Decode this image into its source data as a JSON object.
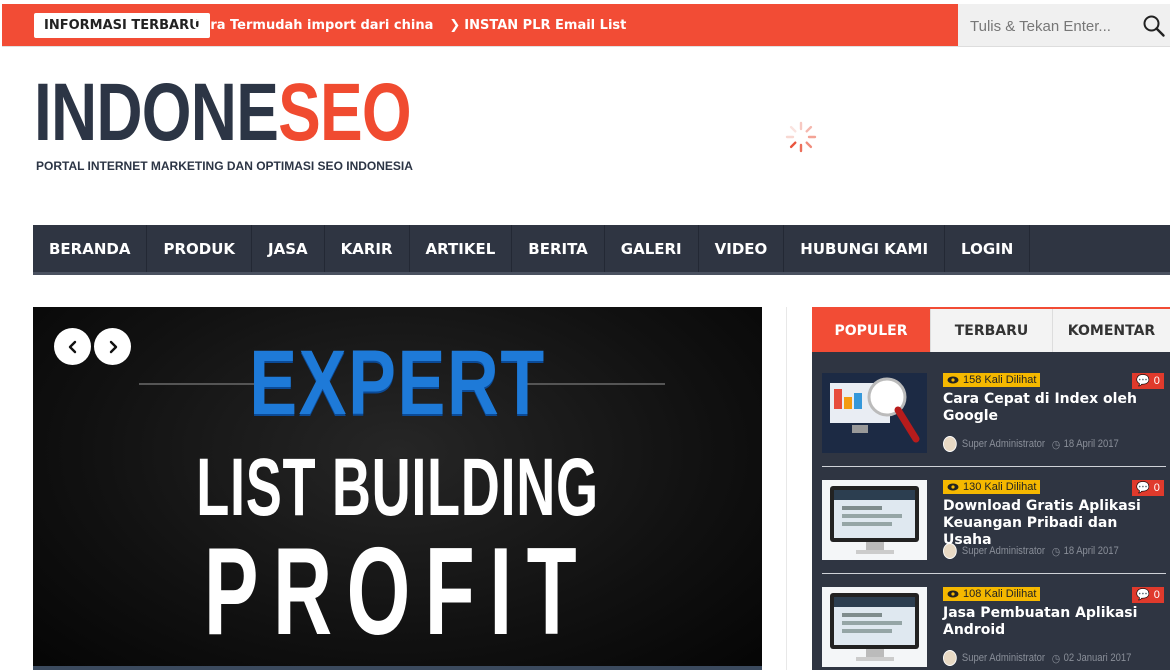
{
  "topbar": {
    "label": "INFORMASI TERBARU",
    "ticker": [
      {
        "text": "Cara Termudah import dari china"
      },
      {
        "text": "INSTAN PLR Email List"
      }
    ],
    "search_placeholder": "Tulis & Tekan Enter...",
    "search_icon": "search-icon",
    "accent": "#f24c35"
  },
  "header": {
    "logo_dark": "INDONE",
    "logo_red": "SEO",
    "tagline": "PORTAL INTERNET MARKETING DAN OPTIMASI SEO INDONESIA",
    "logo_dark_color": "#2c3545",
    "logo_red_color": "#f04b30"
  },
  "nav": {
    "items": [
      {
        "label": "BERANDA"
      },
      {
        "label": "PRODUK"
      },
      {
        "label": "JASA"
      },
      {
        "label": "KARIR"
      },
      {
        "label": "ARTIKEL"
      },
      {
        "label": "BERITA"
      },
      {
        "label": "GALERI"
      },
      {
        "label": "VIDEO"
      },
      {
        "label": "HUBUNGI KAMI"
      },
      {
        "label": "LOGIN"
      }
    ],
    "background": "#2f3542"
  },
  "slider": {
    "line1": "EXPERT",
    "line2": "LIST BUILDING",
    "line3": "PROFIT",
    "prev_icon": "chevron-left-icon",
    "next_icon": "chevron-right-icon"
  },
  "sidebar": {
    "tabs": [
      {
        "label": "POPULER",
        "active": true
      },
      {
        "label": "TERBARU",
        "active": false
      },
      {
        "label": "KOMENTAR",
        "active": false
      }
    ],
    "posts": [
      {
        "views": "158 Kali Dilihat",
        "comments": "0",
        "title": "Cara Cepat di Index oleh Google",
        "author": "Super Administrator",
        "date": "18 April 2017"
      },
      {
        "views": "130 Kali Dilihat",
        "comments": "0",
        "title": "Download Gratis Aplikasi Keuangan Pribadi dan Usaha",
        "author": "Super Administrator",
        "date": "18 April 2017"
      },
      {
        "views": "108 Kali Dilihat",
        "comments": "0",
        "title": "Jasa Pembuatan Aplikasi Android",
        "author": "Super Administrator",
        "date": "02 Januari 2017"
      }
    ],
    "views_badge_color": "#f5b800",
    "comment_badge_color": "#e03a2c"
  }
}
